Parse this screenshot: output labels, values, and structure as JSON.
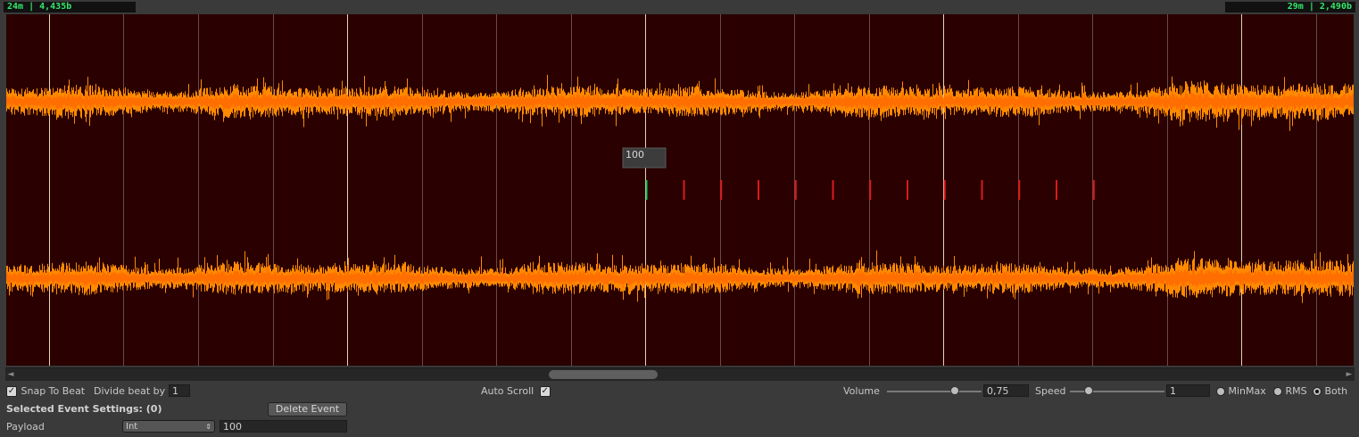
{
  "timecodes": {
    "left": "24m | 4,435b",
    "right": "29m | 2,490b"
  },
  "waveform": {
    "background": "#2a0000",
    "wave_color": "#ff8a00",
    "wave_inner_color": "#ff6e00",
    "grid_color": "#6a4a4a",
    "major_grid_color": "#e6d2b4",
    "playhead_color": "#22c55e",
    "marker_color": "#dc1a1a",
    "beat_marker_count": 12,
    "event_payload_popup": "100"
  },
  "scrollbar": {
    "left_arrow": "◄",
    "right_arrow": "►"
  },
  "controls": {
    "snap_to_beat_label": "Snap To Beat",
    "snap_to_beat_checked": true,
    "divide_beat_label": "Divide beat by",
    "divide_beat_value": "1",
    "auto_scroll_label": "Auto Scroll",
    "auto_scroll_checked": true,
    "volume_label": "Volume",
    "volume_value": "0,75",
    "speed_label": "Speed",
    "speed_value": "1",
    "display_modes": [
      "MinMax",
      "RMS",
      "Both"
    ],
    "selected_display_mode": "Both"
  },
  "event_settings": {
    "title": "Selected Event Settings: (0)",
    "delete_button": "Delete Event",
    "payload_label": "Payload",
    "payload_type": "Int",
    "payload_value": "100"
  }
}
